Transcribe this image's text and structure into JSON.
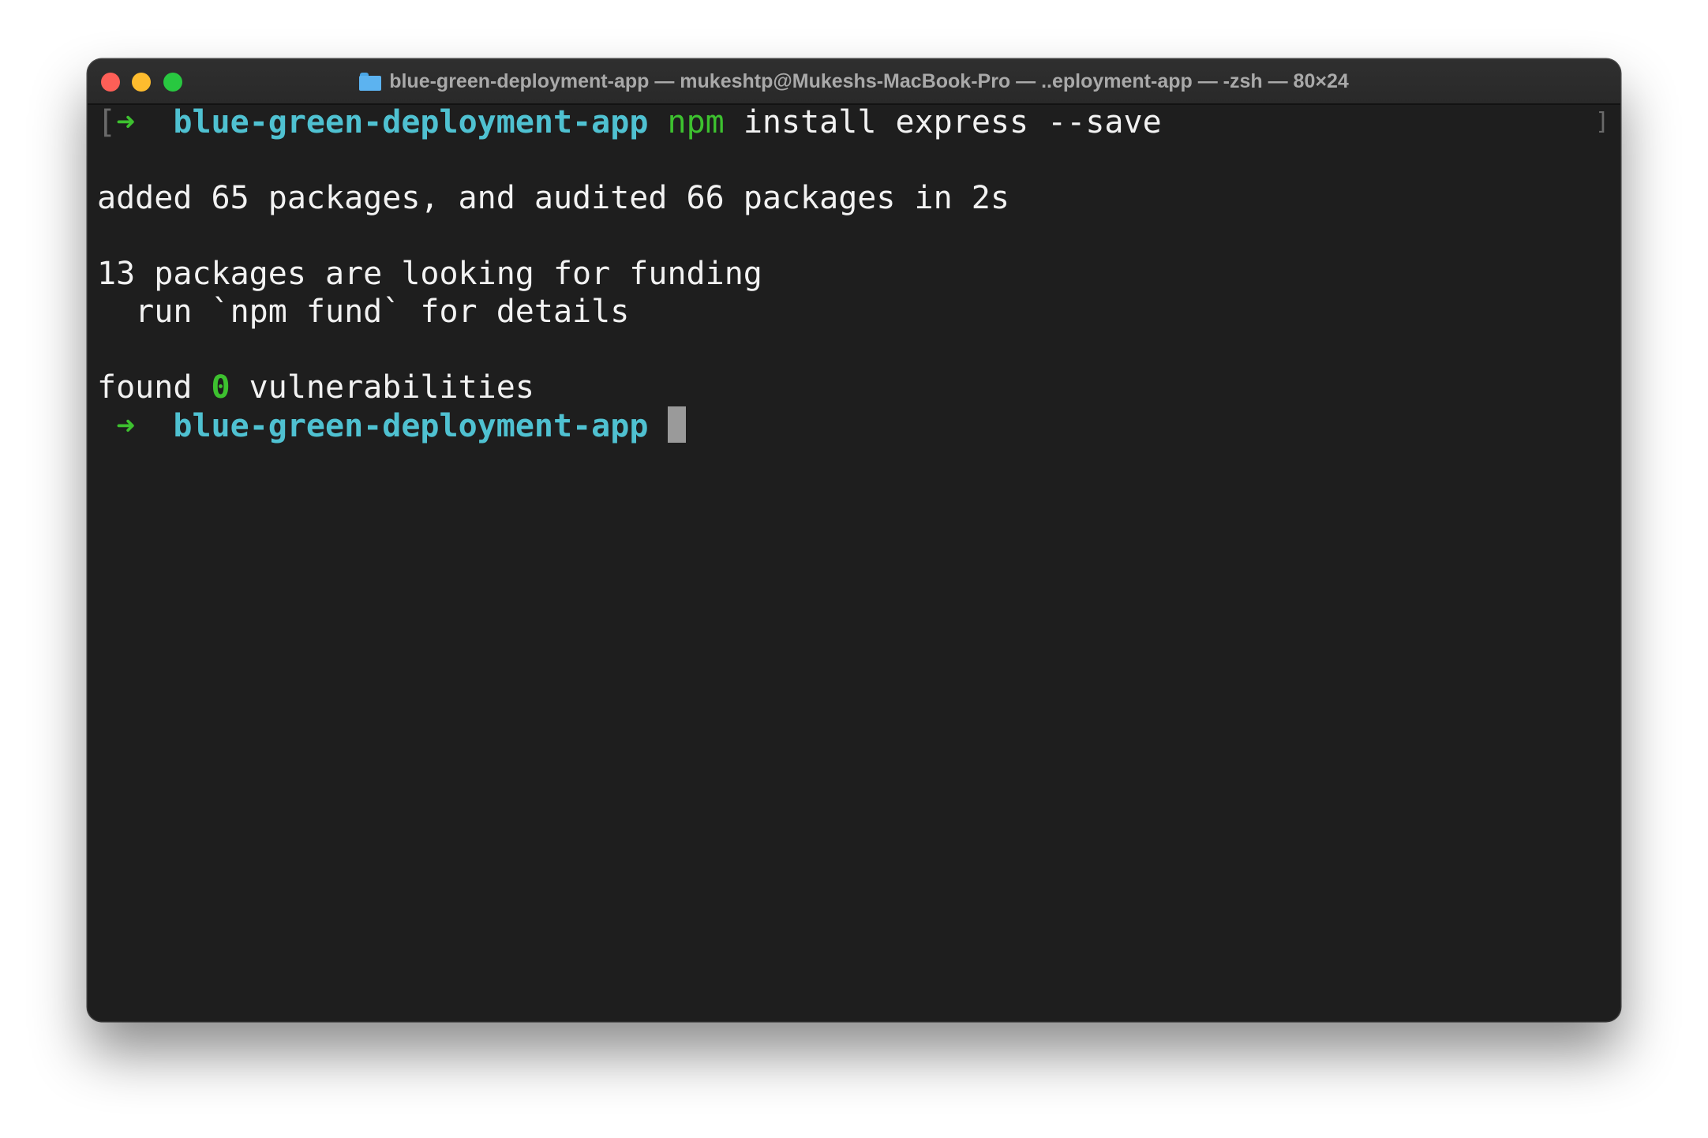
{
  "window": {
    "title": "blue-green-deployment-app — mukeshtp@Mukeshs-MacBook-Pro — ..eployment-app — -zsh — 80×24",
    "folder_icon": "folder-icon"
  },
  "terminal": {
    "prompt_arrow": "➜",
    "prompt_dir": "blue-green-deployment-app",
    "command_name": "npm",
    "command_args": " install express --save",
    "output_added": "added 65 packages, and audited 66 packages in 2s",
    "output_funding": "13 packages are looking for funding",
    "output_fund_hint": "  run `npm fund` for details",
    "output_found_prefix": "found ",
    "output_vuln_count": "0",
    "output_found_suffix": " vulnerabilities"
  },
  "colors": {
    "background": "#1e1e1e",
    "titlebar": "#2c2c2c",
    "prompt_dir": "#4fc1d1",
    "prompt_arrow": "#3dc12f",
    "text": "#f2f2f2",
    "traffic_close": "#fe5f57",
    "traffic_minimize": "#febc2e",
    "traffic_zoom": "#28c840"
  }
}
